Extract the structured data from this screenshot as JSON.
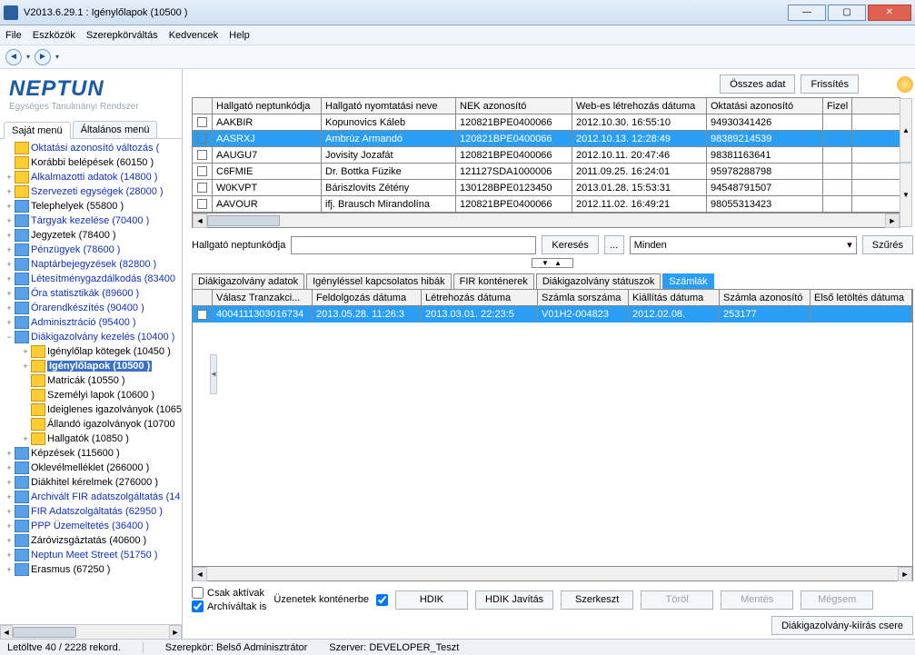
{
  "window": {
    "title": "V2013.6.29.1 : Igénylőlapok (10500  )"
  },
  "menubar": {
    "items": [
      "File",
      "Eszközök",
      "Szerepkörváltás",
      "Kedvencek",
      "Help"
    ]
  },
  "sidebar": {
    "tabs": {
      "active": "Saját menü",
      "other": "Általános menü"
    },
    "logo": "NEPTUN",
    "logo_sub": "Egységes Tanulmányi Rendszer",
    "items": [
      {
        "l": "Oktatási azonosító változás (",
        "ind": 0,
        "exp": "",
        "blue": true
      },
      {
        "l": "Korábbi belépések (60150  )",
        "ind": 0,
        "exp": "",
        "blue": false
      },
      {
        "l": "Alkalmazotti adatok (14800  )",
        "ind": 0,
        "exp": "+",
        "blue": true
      },
      {
        "l": "Szervezeti egységek (28000  )",
        "ind": 0,
        "exp": "+",
        "blue": true
      },
      {
        "l": "Telephelyek (55800  )",
        "ind": 0,
        "exp": "+",
        "blue": false,
        "iconBlue": true
      },
      {
        "l": "Tárgyak kezelése (70400  )",
        "ind": 0,
        "exp": "+",
        "blue": true,
        "iconBlue": true
      },
      {
        "l": "Jegyzetek (78400  )",
        "ind": 0,
        "exp": "+",
        "blue": false,
        "iconBlue": true
      },
      {
        "l": "Pénzügyek (78600  )",
        "ind": 0,
        "exp": "+",
        "blue": true,
        "iconBlue": true
      },
      {
        "l": "Naptárbejegyzések (82800  )",
        "ind": 0,
        "exp": "+",
        "blue": true,
        "iconBlue": true
      },
      {
        "l": "Létesítménygazdálkodás (83400",
        "ind": 0,
        "exp": "+",
        "blue": true,
        "iconBlue": true
      },
      {
        "l": "Óra statisztikák (89600  )",
        "ind": 0,
        "exp": "+",
        "blue": true,
        "iconBlue": true
      },
      {
        "l": "Órarendkészítés (90400  )",
        "ind": 0,
        "exp": "+",
        "blue": true,
        "iconBlue": true
      },
      {
        "l": "Adminisztráció (95400  )",
        "ind": 0,
        "exp": "+",
        "blue": true,
        "iconBlue": true
      },
      {
        "l": "Diákigazolvány kezelés (10400  )",
        "ind": 0,
        "exp": "−",
        "blue": true,
        "iconBlue": true
      },
      {
        "l": "Igénylőlap kötegek (10450  )",
        "ind": 1,
        "exp": "+",
        "blue": false
      },
      {
        "l": "Igénylőlapok (10500  )",
        "ind": 1,
        "exp": "+",
        "blue": false,
        "selected": true
      },
      {
        "l": "Matricák (10550  )",
        "ind": 1,
        "exp": "",
        "blue": false
      },
      {
        "l": "Személyi lapok (10600  )",
        "ind": 1,
        "exp": "",
        "blue": false
      },
      {
        "l": "Ideiglenes igazolványok (1065",
        "ind": 1,
        "exp": "",
        "blue": false
      },
      {
        "l": "Állandó igazolványok (10700",
        "ind": 1,
        "exp": "",
        "blue": false
      },
      {
        "l": "Hallgatók (10850  )",
        "ind": 1,
        "exp": "+",
        "blue": false
      },
      {
        "l": "Képzések (115600  )",
        "ind": 0,
        "exp": "+",
        "blue": false,
        "iconBlue": true
      },
      {
        "l": "Oklevélmelléklet (266000  )",
        "ind": 0,
        "exp": "+",
        "blue": false,
        "iconBlue": true
      },
      {
        "l": "Diákhitel kérelmek (276000  )",
        "ind": 0,
        "exp": "+",
        "blue": false,
        "iconBlue": true
      },
      {
        "l": "Archivált FIR adatszolgáltatás (14",
        "ind": 0,
        "exp": "+",
        "blue": true,
        "iconBlue": true
      },
      {
        "l": "FIR Adatszolgáltatás (62950  )",
        "ind": 0,
        "exp": "+",
        "blue": true,
        "iconBlue": true
      },
      {
        "l": "PPP Üzemeltetés (36400  )",
        "ind": 0,
        "exp": "+",
        "blue": true,
        "iconBlue": true
      },
      {
        "l": "Záróvizsgáztatás (40600  )",
        "ind": 0,
        "exp": "+",
        "blue": false,
        "iconBlue": true
      },
      {
        "l": "Neptun Meet Street (51750  )",
        "ind": 0,
        "exp": "+",
        "blue": true,
        "iconBlue": true
      },
      {
        "l": "Erasmus (67250  )",
        "ind": 0,
        "exp": "+",
        "blue": false,
        "iconBlue": true
      }
    ]
  },
  "topbtns": {
    "all": "Összes adat",
    "refresh": "Frissítés"
  },
  "grid": {
    "headers": [
      "",
      "Hallgató neptunkódja",
      "Hallgató nyomtatási neve",
      "NEK azonosító",
      "Web-es létrehozás dátuma",
      "Oktatási azonosító",
      "Fizel"
    ],
    "rows": [
      {
        "c": [
          "",
          "AAKBIR",
          "Kopunovics Káleb",
          "120821BPE0400066",
          "2012.10.30. 16:55:10",
          "94930341426",
          ""
        ]
      },
      {
        "c": [
          "",
          "AASRXJ",
          "Ambrúz Armandó",
          "120821BPE0400066",
          "2012.10.13. 12:28:49",
          "98389214539",
          ""
        ],
        "sel": true
      },
      {
        "c": [
          "",
          "AAUGU7",
          "Jovisity Jozafát",
          "120821BPE0400066",
          "2012.10.11. 20:47:46",
          "98381163641",
          ""
        ]
      },
      {
        "c": [
          "",
          "C6FMIE",
          "Dr. Bottka Füzike",
          "121127SDA1000006",
          "2011.09.25. 16:24:01",
          "95978288798",
          ""
        ]
      },
      {
        "c": [
          "",
          "W0KVPT",
          "Báriszlovits Zétény",
          "130128BPE0123450",
          "2013.01.28. 15:53:31",
          "94548791507",
          ""
        ]
      },
      {
        "c": [
          "",
          "AAVOUR",
          "ifj. Brausch Mirandolína",
          "120821BPE0400066",
          "2012.11.02. 16:49:21",
          "98055313423",
          ""
        ]
      }
    ]
  },
  "search": {
    "label": "Hallgató neptunkódja",
    "value": "",
    "btn": "Keresés",
    "ell": "...",
    "dd": "Minden",
    "filter": "Szűrés"
  },
  "tabs2": [
    "Diákigazolvány adatok",
    "Igényléssel kapcsolatos hibák",
    "FIR konténerek",
    "Diákigazolvány státuszok",
    "Számlák"
  ],
  "tabs2_active": 4,
  "detail": {
    "headers": [
      "",
      "Válasz Tranzakci...",
      "Feldolgozás dátuma",
      "Létrehozás dátuma",
      "Számla sorszáma",
      "Kiállítás dátuma",
      "Számla azonosító",
      "Első letöltés dátuma"
    ],
    "row": [
      "",
      "4004111303016734",
      "2013.05.28. 11:26:3",
      "2013.03.01. 22:23:5",
      "V01H2-004823",
      "2012.02.08.",
      "253177",
      ""
    ]
  },
  "bottom": {
    "only_active": "Csak aktívak",
    "archived": "Archíváltak is",
    "msg_container": "Üzenetek konténerbe",
    "hdik": "HDIK",
    "hdik_fix": "HDIK Javítás",
    "edit": "Szerkeszt",
    "del": "Töröl",
    "save": "Mentés",
    "cancel": "Mégsem",
    "swap": "Diákigazolvány-kiírás csere"
  },
  "status": {
    "left": "Letöltve 40 / 2228 rekord.",
    "role_l": "Szerepkör:",
    "role_v": "Belső Adminisztrátor",
    "server_l": "Szerver:",
    "server_v": "DEVELOPER_Teszt"
  }
}
